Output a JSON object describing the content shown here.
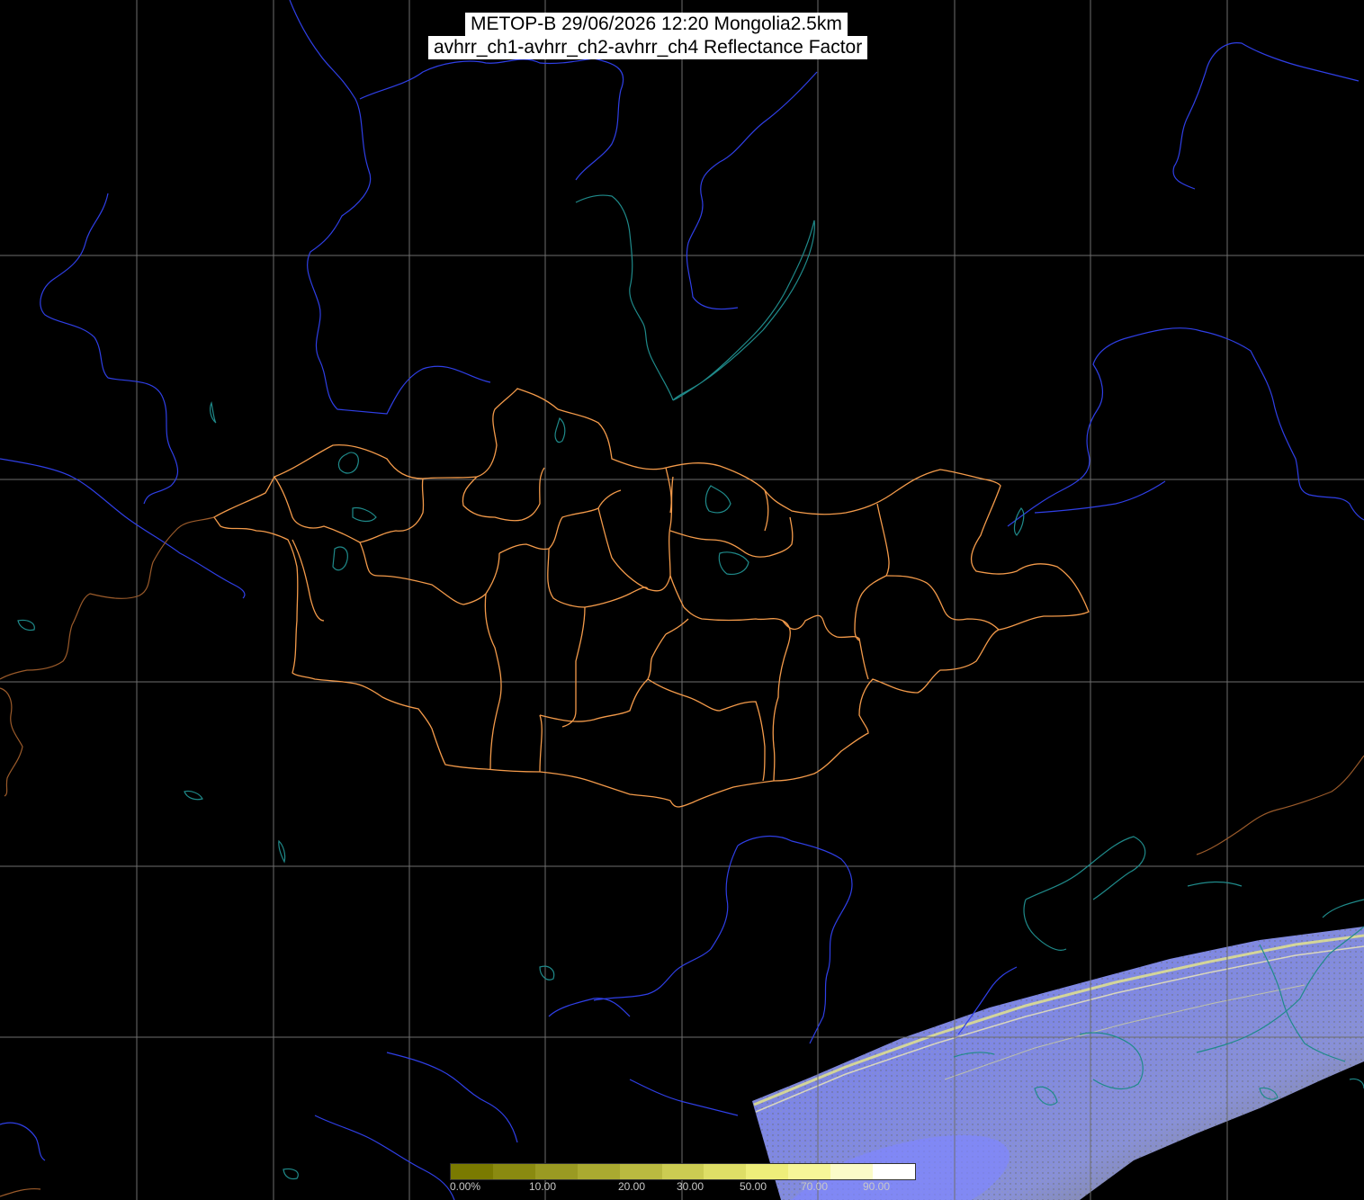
{
  "title": {
    "line1": "METOP-B 29/06/2026 12:20 Mongolia2.5km",
    "line2": "avhrr_ch1-avhrr_ch2-avhrr_ch4 Reflectance Factor"
  },
  "colors": {
    "background": "#000000",
    "graticule": "#6e6e6e",
    "rivers": "#2f3fe6",
    "lakes_coast": "#1f8a8a",
    "admin_borders": "#f39a4a",
    "country_borders_other": "#9a5a2a",
    "swath_cloud": "#7b84f0",
    "swath_ground": "#8c8a5a"
  },
  "colorbar": {
    "colors": [
      "#7a7a00",
      "#8a8a10",
      "#9a9a22",
      "#aaaa30",
      "#baba40",
      "#cccc52",
      "#dede66",
      "#eeee7a",
      "#f6f698",
      "#fbfbc8",
      "#ffffff"
    ],
    "ticks": [
      "0.00%",
      "10.00",
      "20.00",
      "30.00",
      "50.00",
      "70.00",
      "90.00"
    ]
  },
  "icons": [
    "graticule-lines",
    "river-lines",
    "lake-outlines",
    "admin-boundary-lines",
    "satellite-swath"
  ]
}
